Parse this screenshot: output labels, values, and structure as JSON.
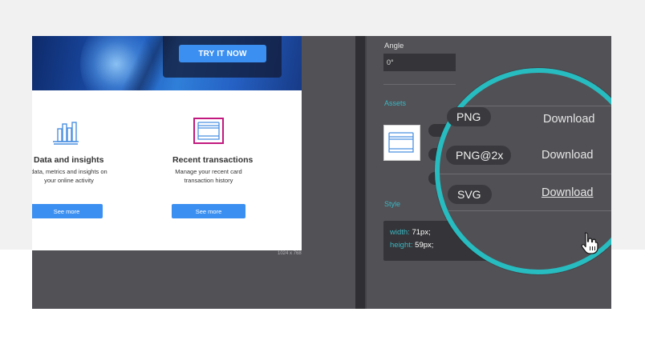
{
  "artboard": {
    "hero_button": "TRY IT NOW",
    "cards": [
      {
        "title": "Data and insights",
        "desc_lines": [
          "data, metrics and insights on",
          "your online activity"
        ],
        "button": "See more",
        "icon": "bar-chart-icon"
      },
      {
        "title": "Recent transactions",
        "desc_lines": [
          "Manage your recent card",
          "transaction history"
        ],
        "button": "See more",
        "icon": "cards-icon"
      }
    ],
    "dimensions": "1024 x 768"
  },
  "inspector": {
    "angle_label": "Angle",
    "angle_value": "0°",
    "assets_label": "Assets",
    "style_label": "Style",
    "style": {
      "width_key": "width:",
      "width_val": "71px;",
      "height_key": "height:",
      "height_val": "59px;"
    }
  },
  "magnifier": {
    "rows": [
      {
        "format": "PNG",
        "action": "Download"
      },
      {
        "format": "PNG@2x",
        "action": "Download"
      },
      {
        "format": "SVG",
        "action": "Download"
      }
    ]
  },
  "colors": {
    "accent_blue": "#3b8ff1",
    "teal": "#26bcc0",
    "panel_bg": "#525156",
    "selection_magenta": "#c2197f"
  }
}
